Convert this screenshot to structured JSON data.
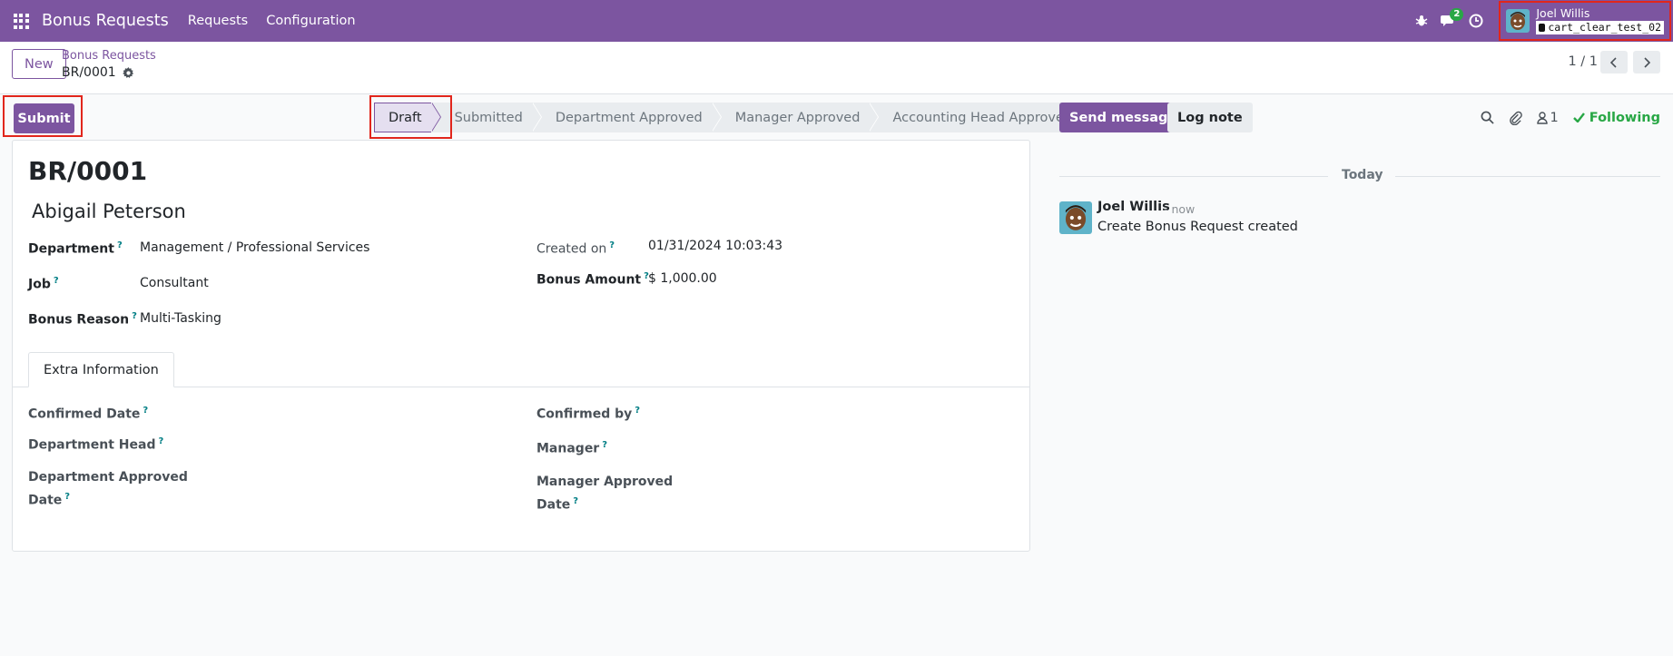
{
  "navbar": {
    "app_name": "Bonus Requests",
    "menus": [
      "Requests",
      "Configuration"
    ],
    "chat_count": "2",
    "user_name": "Joel Willis",
    "database": "cart_clear_test_02",
    "color": "#7c55a0"
  },
  "control_panel": {
    "new_label": "New",
    "breadcrumb_parent": "Bonus Requests",
    "breadcrumb_current": "BR/0001",
    "pager": "1 / 1"
  },
  "actions": {
    "submit_label": "Submit"
  },
  "statusbar": {
    "stages": [
      "Draft",
      "Submitted",
      "Department Approved",
      "Manager Approved",
      "Accounting Head Approved"
    ],
    "active": "Draft"
  },
  "form": {
    "record_name": "BR/0001",
    "employee": "Abigail Peterson",
    "department_label": "Department",
    "department_value": "Management / Professional Services",
    "job_label": "Job",
    "job_value": "Consultant",
    "bonus_reason_label": "Bonus Reason",
    "bonus_reason_value": "Multi-Tasking",
    "created_on_label": "Created on",
    "created_on_value": "01/31/2024 10:03:43",
    "bonus_amount_label": "Bonus Amount",
    "bonus_amount_value": "$ 1,000.00",
    "tab_label": "Extra Information",
    "confirmed_date_label": "Confirmed Date",
    "department_head_label": "Department Head",
    "department_approved_date_label_1": "Department Approved",
    "department_approved_date_label_2": "Date",
    "confirmed_by_label": "Confirmed by",
    "manager_label": "Manager",
    "manager_approved_date_label_1": "Manager Approved",
    "manager_approved_date_label_2": "Date",
    "help_mark": "?"
  },
  "chatter": {
    "send_message_label": "Send message",
    "log_note_label": "Log note",
    "followers_count": "1",
    "following_label": "Following",
    "date_separator": "Today",
    "messages": [
      {
        "author": "Joel Willis",
        "time": "- now",
        "body": "Create Bonus Request created"
      }
    ]
  }
}
